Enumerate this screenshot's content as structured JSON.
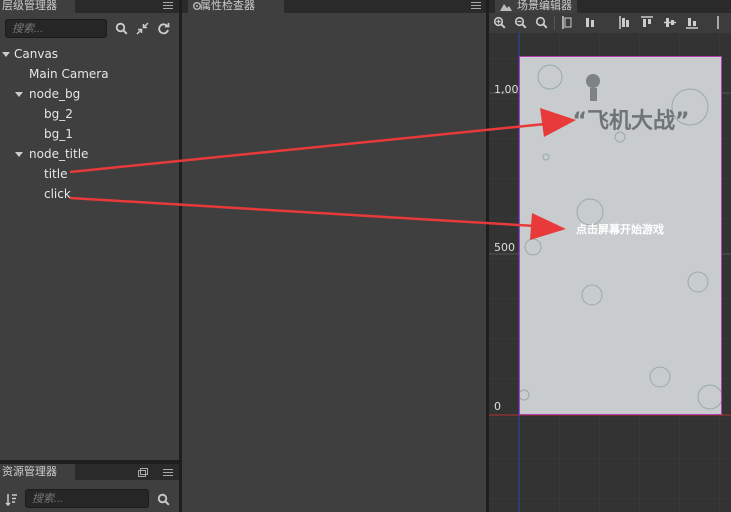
{
  "hierarchy": {
    "title": "层级管理器",
    "search_placeholder": "搜索...",
    "nodes": [
      {
        "label": "Canvas"
      },
      {
        "label": "Main Camera"
      },
      {
        "label": "node_bg"
      },
      {
        "label": "bg_2"
      },
      {
        "label": "bg_1"
      },
      {
        "label": "node_title"
      },
      {
        "label": "title"
      },
      {
        "label": "click"
      }
    ]
  },
  "assets": {
    "title": "资源管理器",
    "search_placeholder": "搜索..."
  },
  "inspector": {
    "title": "属性检查器"
  },
  "scene": {
    "title": "场景编辑器",
    "ruler_labels": [
      "1,000",
      "500",
      "0"
    ],
    "game_title": "“飞机大战”",
    "game_hint": "点击屏幕开始游戏"
  },
  "colors": {
    "arrow": "#e83a3a",
    "canvas_border": "#b040b0",
    "canvas_bg": "#c8ccce",
    "x_axis": "#b03030",
    "y_axis": "#3040b0"
  }
}
